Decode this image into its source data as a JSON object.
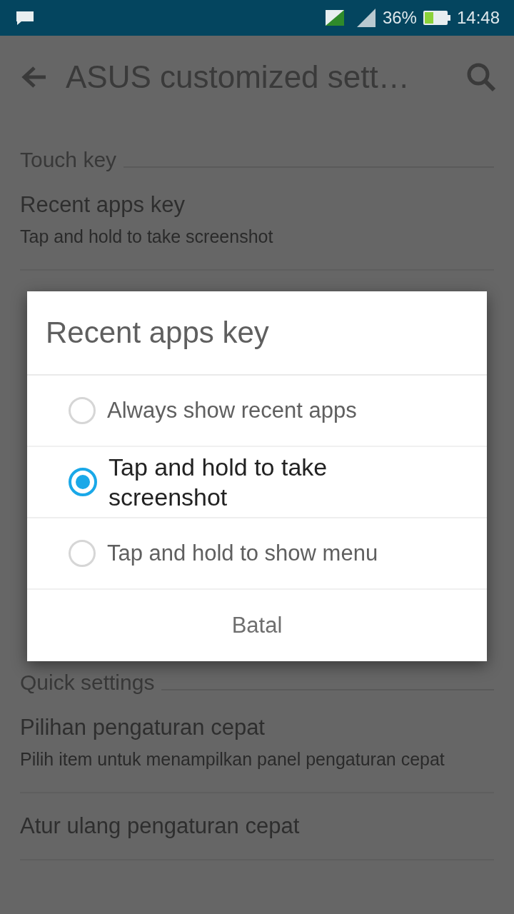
{
  "status_bar": {
    "battery": "36%",
    "time": "14:48"
  },
  "toolbar": {
    "title": "ASUS customized sett…"
  },
  "sections": [
    {
      "header": "Touch key",
      "items": [
        {
          "title": "Recent apps key",
          "summary": "Tap and hold to take screenshot"
        }
      ]
    },
    {
      "header": "Quick settings",
      "items": [
        {
          "title": "Pilihan pengaturan cepat",
          "summary": "Pilih item untuk menampilkan panel pengaturan cepat"
        },
        {
          "title": "Atur ulang pengaturan cepat"
        }
      ]
    }
  ],
  "dialog": {
    "title": "Recent apps key",
    "options": [
      {
        "label": "Always show recent apps",
        "selected": false
      },
      {
        "label": "Tap and hold to take screenshot",
        "selected": true
      },
      {
        "label": "Tap and hold to show menu",
        "selected": false
      }
    ],
    "cancel": "Batal"
  }
}
